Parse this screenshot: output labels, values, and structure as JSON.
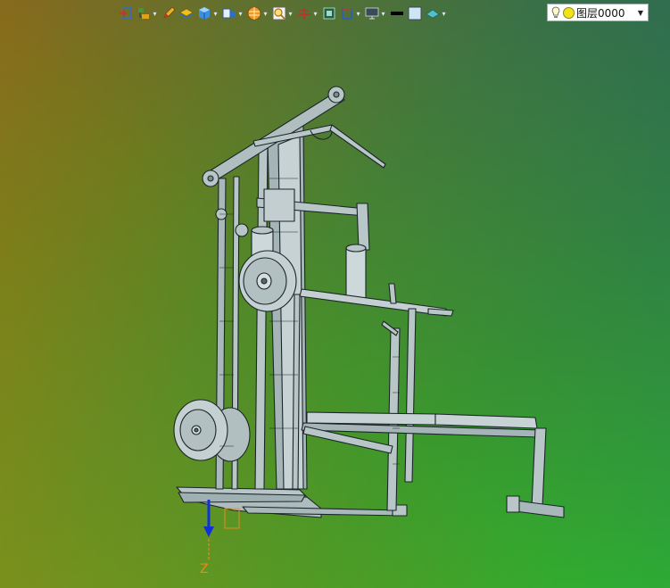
{
  "toolbar": {
    "items": [
      {
        "name": "exit-sketch-icon"
      },
      {
        "name": "feature-tree-icon",
        "dropdown": true
      },
      {
        "name": "pencil-icon"
      },
      {
        "name": "layer-stack-icon"
      },
      {
        "name": "solid-cube-icon",
        "dropdown": true
      },
      {
        "name": "shaded-view-icon",
        "dropdown": true
      },
      {
        "name": "render-sphere-icon",
        "dropdown": true
      },
      {
        "name": "zoom-fit-icon",
        "dropdown": true
      },
      {
        "name": "rotate-axis-icon",
        "dropdown": true
      },
      {
        "name": "section-view-icon"
      },
      {
        "name": "dimension-icon",
        "dropdown": true
      },
      {
        "name": "display-monitor-icon",
        "dropdown": true
      },
      {
        "name": "line-color-icon"
      },
      {
        "name": "fill-color-icon"
      },
      {
        "name": "surface-style-icon",
        "dropdown": true
      }
    ]
  },
  "layer": {
    "value": "图层0000"
  },
  "axis": {
    "label": "Z"
  },
  "colors": {
    "model_fill": "#b8c4c6",
    "model_stroke": "#1e2a2e",
    "axis_arrow": "#1030d8",
    "axis_label": "#e88a1a"
  }
}
